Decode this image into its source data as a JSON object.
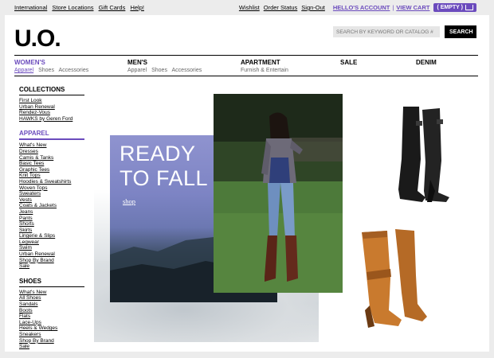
{
  "topbar": {
    "links": [
      "International",
      "Store Locations",
      "Gift Cards",
      "Help!"
    ],
    "wishlist": "Wishlist",
    "order_status": "Order Status",
    "sign_out": "Sign-Out",
    "hello": "HELLO'S ACCOUNT",
    "separator": "|",
    "view_cart": "VIEW CART",
    "empty": "( EMPTY )"
  },
  "logo": "U.O.",
  "search": {
    "placeholder": "SEARCH BY KEYWORD OR CATALOG #",
    "button": "SEARCH"
  },
  "nav": {
    "womens": {
      "label": "WOMEN'S",
      "subs": [
        "Apparel",
        "Shoes",
        "Accessories"
      ]
    },
    "mens": {
      "label": "MEN'S",
      "subs": [
        "Apparel",
        "Shoes",
        "Accessories"
      ]
    },
    "apartment": {
      "label": "APARTMENT",
      "subs": [
        "Furnish & Entertain"
      ]
    },
    "sale": {
      "label": "SALE"
    },
    "denim": {
      "label": "DENIM"
    }
  },
  "sidebar": {
    "collections": {
      "title": "COLLECTIONS",
      "items": [
        "First Look",
        "Urban Renewal",
        "Rendez-Vous",
        "HAWKS by Geren Ford"
      ]
    },
    "apparel": {
      "title": "APPAREL",
      "items": [
        "What's New",
        "Dresses",
        "Camis & Tanks",
        "Basic Tees",
        "Graphic Tees",
        "Knit Tops",
        "Hoodies & Sweatshirts",
        "Woven Tops",
        "Sweaters",
        "Vests",
        "Coats & Jackets",
        "Jeans",
        "Pants",
        "Shorts",
        "Skirts",
        "Lingerie & Slips",
        "Legwear",
        "Swim",
        "Urban Renewal",
        "Shop By Brand",
        "Sale"
      ]
    },
    "shoes": {
      "title": "SHOES",
      "items": [
        "What's New",
        "All Shoes",
        "Sandals",
        "Boots",
        "Flats",
        "Lace-Ups",
        "Heels & Wedges",
        "Sneakers",
        "Shop By Brand",
        "Sale"
      ]
    }
  },
  "hero": {
    "headline_1": "READY",
    "headline_2": "TO FALL",
    "shop": "shop"
  },
  "colors": {
    "accent": "#6b4bbd",
    "panel": "#7d84c4",
    "boot_black": "#1a1a1a",
    "boot_tan": "#c97a2e"
  }
}
